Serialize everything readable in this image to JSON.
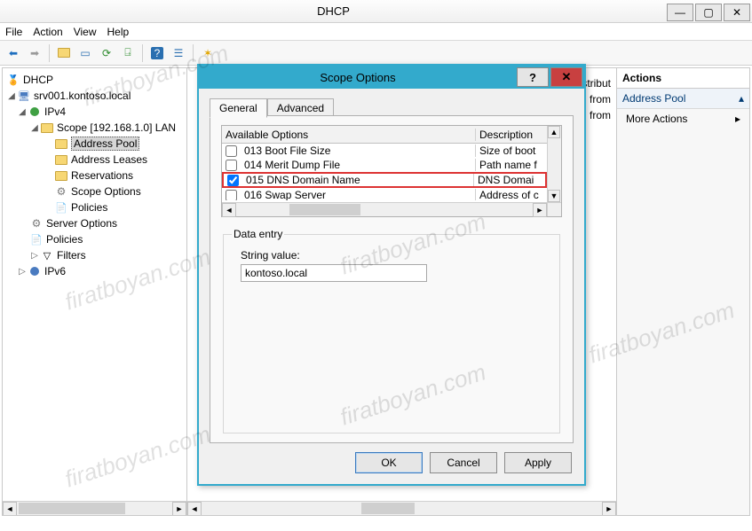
{
  "window": {
    "title": "DHCP"
  },
  "menu": {
    "file": "File",
    "action": "Action",
    "view": "View",
    "help": "Help"
  },
  "tree": {
    "root": "DHCP",
    "server": "srv001.kontoso.local",
    "ipv4": "IPv4",
    "scope": "Scope [192.168.1.0] LAN",
    "addressPool": "Address Pool",
    "addressLeases": "Address Leases",
    "reservations": "Reservations",
    "scopeOptions": "Scope Options",
    "policies": "Policies",
    "serverOptions": "Server Options",
    "policies2": "Policies",
    "filters": "Filters",
    "ipv6": "IPv6"
  },
  "center": {
    "line1": "or distribut",
    "line2": "cluded from",
    "line3": "cluded from"
  },
  "actions": {
    "header": "Actions",
    "sub": "Address Pool",
    "item1": "More Actions"
  },
  "dialog": {
    "title": "Scope Options",
    "tabs": {
      "general": "General",
      "advanced": "Advanced"
    },
    "cols": {
      "a": "Available Options",
      "b": "Description"
    },
    "opts": [
      {
        "name": "013 Boot File Size",
        "desc": "Size of boot",
        "chk": false
      },
      {
        "name": "014 Merit Dump File",
        "desc": "Path name f",
        "chk": false
      },
      {
        "name": "015 DNS Domain Name",
        "desc": "DNS Domai",
        "chk": true
      },
      {
        "name": "016 Swap Server",
        "desc": "Address of c",
        "chk": false
      }
    ],
    "dataEntry": {
      "legend": "Data entry",
      "label": "String value:",
      "value": "kontoso.local"
    },
    "btns": {
      "ok": "OK",
      "cancel": "Cancel",
      "apply": "Apply"
    }
  }
}
